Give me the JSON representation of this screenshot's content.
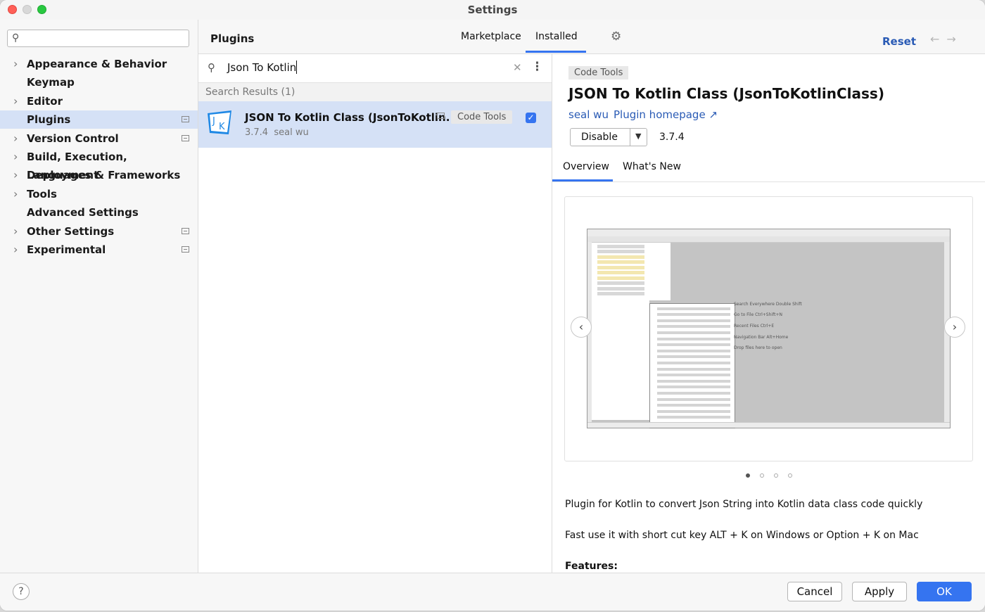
{
  "window": {
    "title": "Settings"
  },
  "sidebar": {
    "search_value": "",
    "items": [
      {
        "label": "Appearance & Behavior",
        "chevron": true,
        "badge": false,
        "selected": false
      },
      {
        "label": "Keymap",
        "chevron": false,
        "badge": false,
        "selected": false
      },
      {
        "label": "Editor",
        "chevron": true,
        "badge": false,
        "selected": false
      },
      {
        "label": "Plugins",
        "chevron": false,
        "badge": true,
        "selected": true
      },
      {
        "label": "Version Control",
        "chevron": true,
        "badge": true,
        "selected": false
      },
      {
        "label": "Build, Execution, Deployment",
        "chevron": true,
        "badge": false,
        "selected": false
      },
      {
        "label": "Languages & Frameworks",
        "chevron": true,
        "badge": false,
        "selected": false
      },
      {
        "label": "Tools",
        "chevron": true,
        "badge": false,
        "selected": false
      },
      {
        "label": "Advanced Settings",
        "chevron": false,
        "badge": false,
        "selected": false
      },
      {
        "label": "Other Settings",
        "chevron": true,
        "badge": true,
        "selected": false
      },
      {
        "label": "Experimental",
        "chevron": true,
        "badge": true,
        "selected": false
      }
    ]
  },
  "header": {
    "title": "Plugins",
    "tabs": [
      "Marketplace",
      "Installed"
    ],
    "active_tab": "Installed",
    "reset_label": "Reset",
    "gear_icon": "gear-icon",
    "back_icon": "arrow-left-icon",
    "forward_icon": "arrow-right-icon"
  },
  "list": {
    "search_value": "Json To Kotlin",
    "results_heading": "Search Results (1)",
    "results": [
      {
        "name": "JSON To Kotlin Class (JsonToKotlin...",
        "tag": "Code Tools",
        "version": "3.7.4",
        "author": "seal wu",
        "enabled": true,
        "logo_text": "JK"
      }
    ]
  },
  "detail": {
    "tag": "Code Tools",
    "title": "JSON To Kotlin Class (JsonToKotlinClass)",
    "author": "seal wu",
    "homepage_label": "Plugin homepage ↗",
    "disable_label": "Disable",
    "version": "3.7.4",
    "tabs": [
      "Overview",
      "What's New"
    ],
    "active_tab": "Overview",
    "screenshot_hints": [
      "Search Everywhere Double Shift",
      "Go to File Ctrl+Shift+N",
      "Recent Files Ctrl+E",
      "Navigation Bar Alt+Home",
      "Drop files here to open"
    ],
    "carousel_dots": 4,
    "carousel_active": 0,
    "description": [
      "Plugin for Kotlin to convert Json String into Kotlin data class code quickly",
      "Fast use it with short cut key ALT + K on Windows or Option + K on Mac"
    ],
    "features_heading": "Features:"
  },
  "footer": {
    "help_label": "?",
    "cancel_label": "Cancel",
    "apply_label": "Apply",
    "ok_label": "OK"
  },
  "colors": {
    "accent": "#3574f0",
    "selection": "#d5e1f6",
    "link": "#2a5bb5"
  }
}
